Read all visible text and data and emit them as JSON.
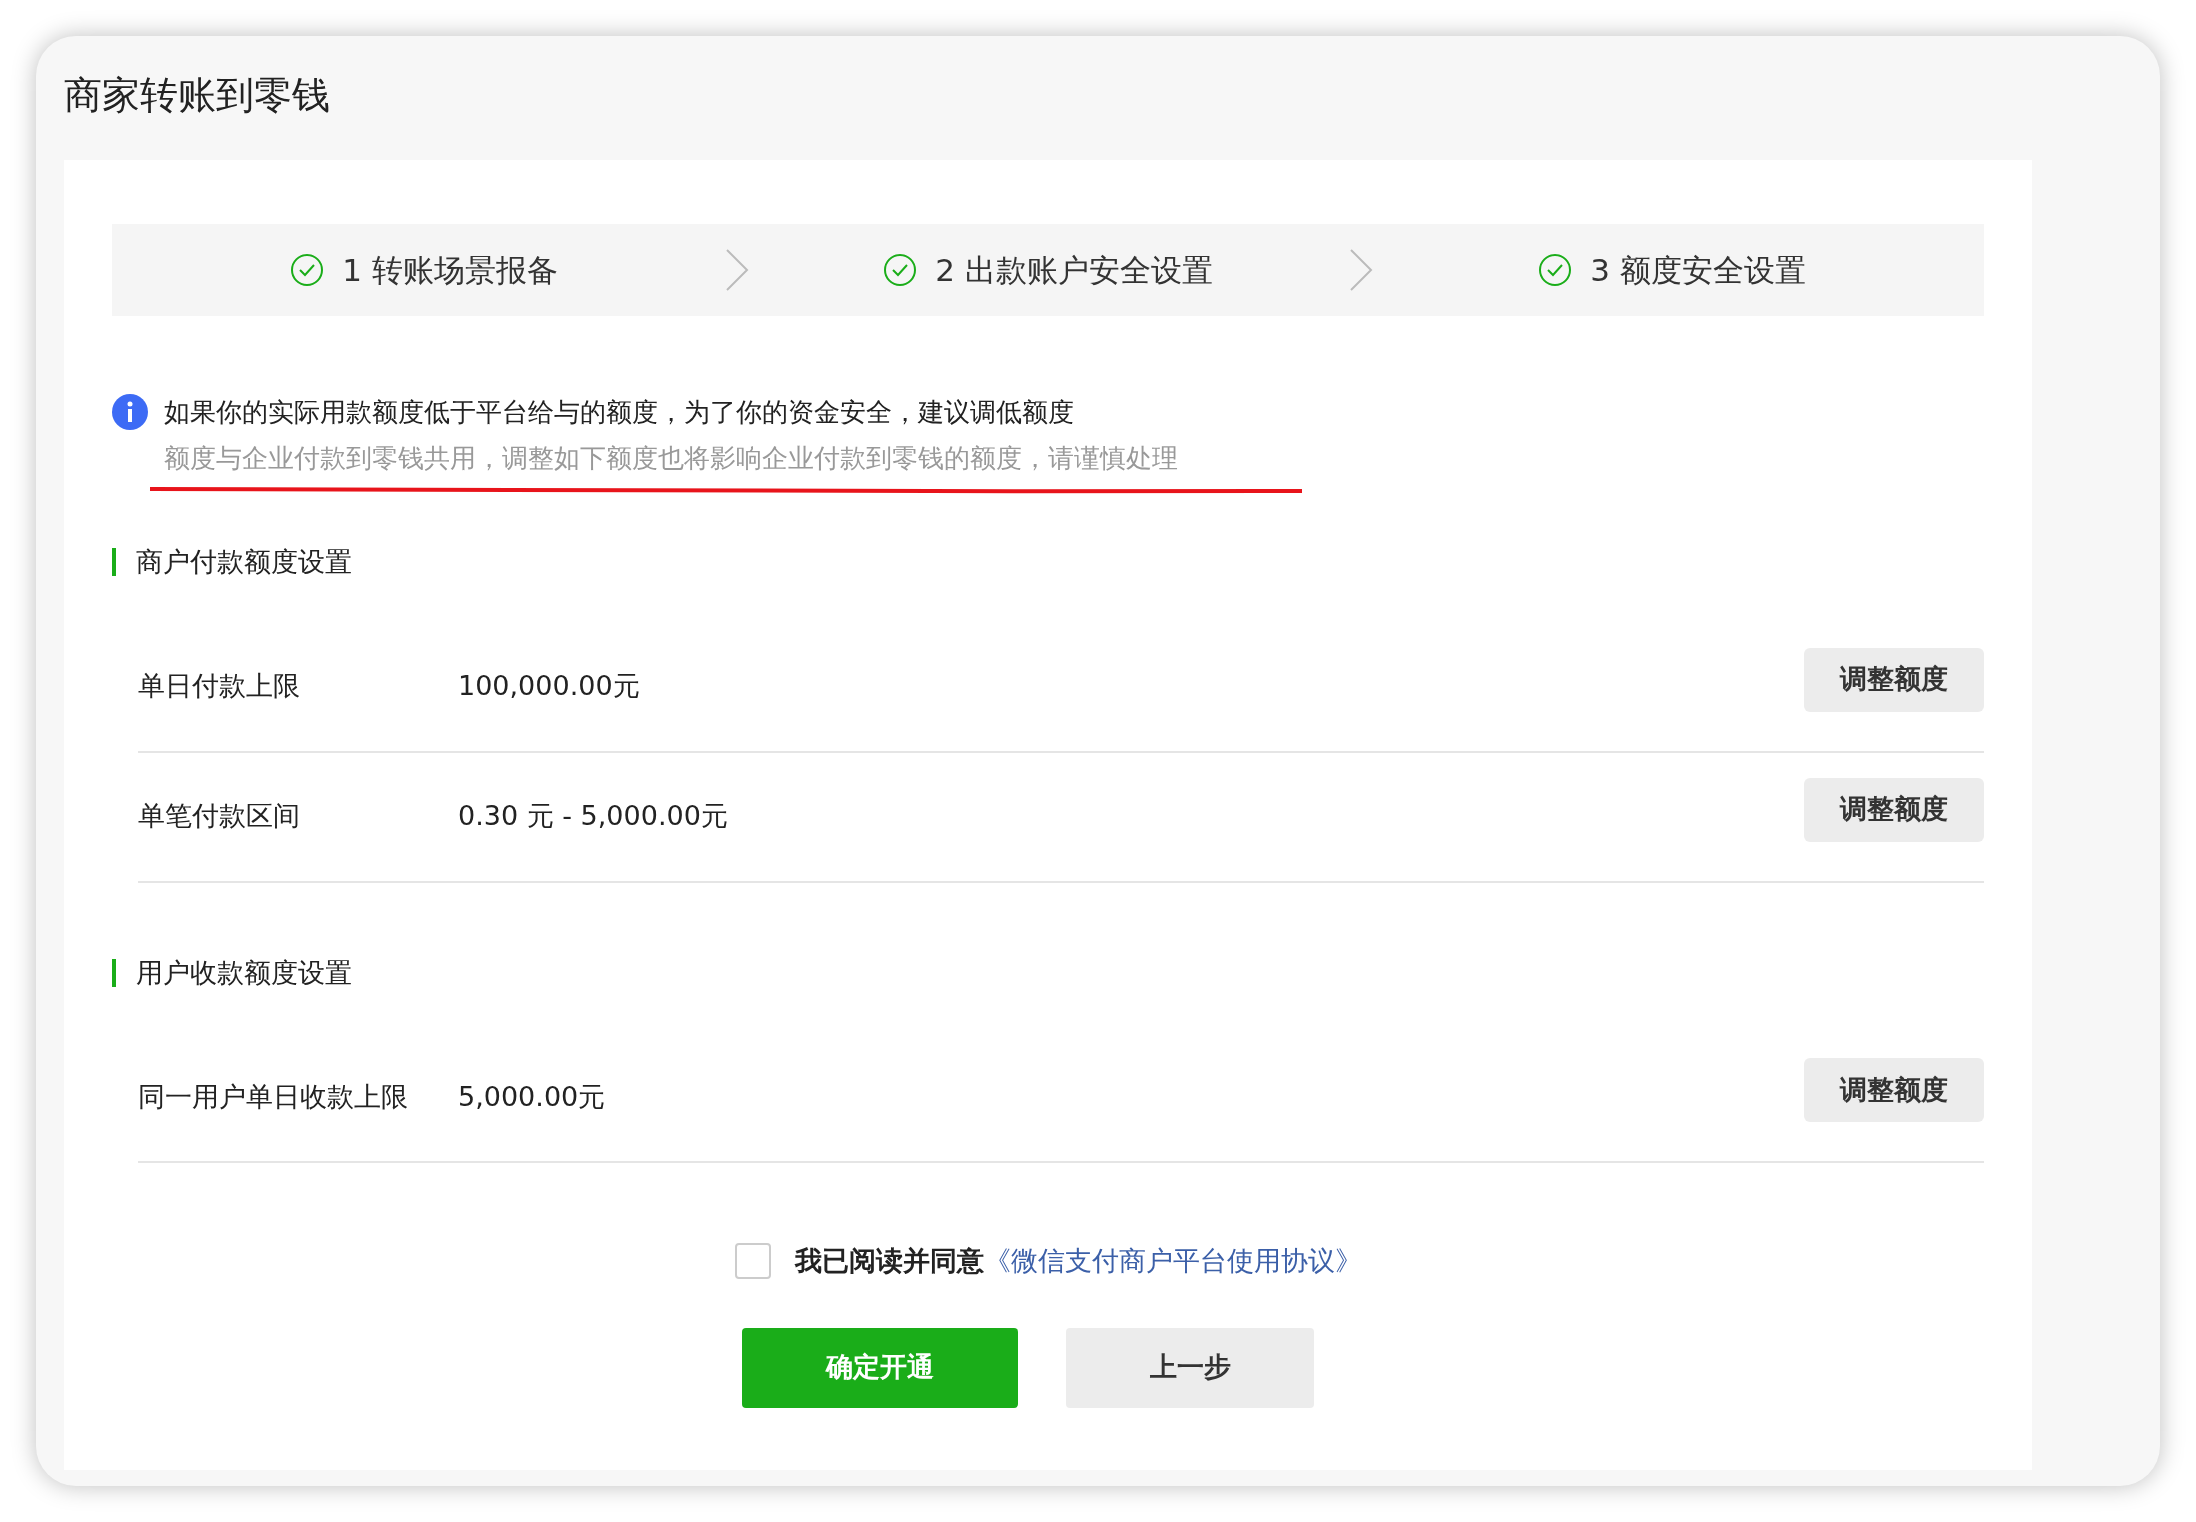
{
  "window": {
    "title": "商家转账到零钱"
  },
  "steps": [
    {
      "label": "1 转账场景报备",
      "completed": true
    },
    {
      "label": "2 出款账户安全设置",
      "completed": true
    },
    {
      "label": "3 额度安全设置",
      "completed": true
    }
  ],
  "notice": {
    "message": "如果你的实际用款额度低于平台给与的额度，为了你的资金安全，建议调低额度",
    "detail": "额度与企业付款到零钱共用，调整如下额度也将影响企业付款到零钱的额度，请谨慎处理"
  },
  "sections": [
    {
      "title": "商户付款额度设置",
      "rows": [
        {
          "label": "单日付款上限",
          "value": "100,000.00元",
          "button": "调整额度"
        },
        {
          "label": "单笔付款区间",
          "value": "0.30 元 - 5,000.00元",
          "button": "调整额度"
        }
      ]
    },
    {
      "title": "用户收款额度设置",
      "rows": [
        {
          "label": "同一用户单日收款上限",
          "value": "5,000.00元",
          "button": "调整额度"
        }
      ]
    }
  ],
  "agreement": {
    "checked": false,
    "text": "我已阅读并同意",
    "link": "《微信支付商户平台使用协议》"
  },
  "buttons": [
    {
      "label": "确定开通",
      "kind": "primary"
    },
    {
      "label": "上一步",
      "kind": "secondary"
    }
  ]
}
